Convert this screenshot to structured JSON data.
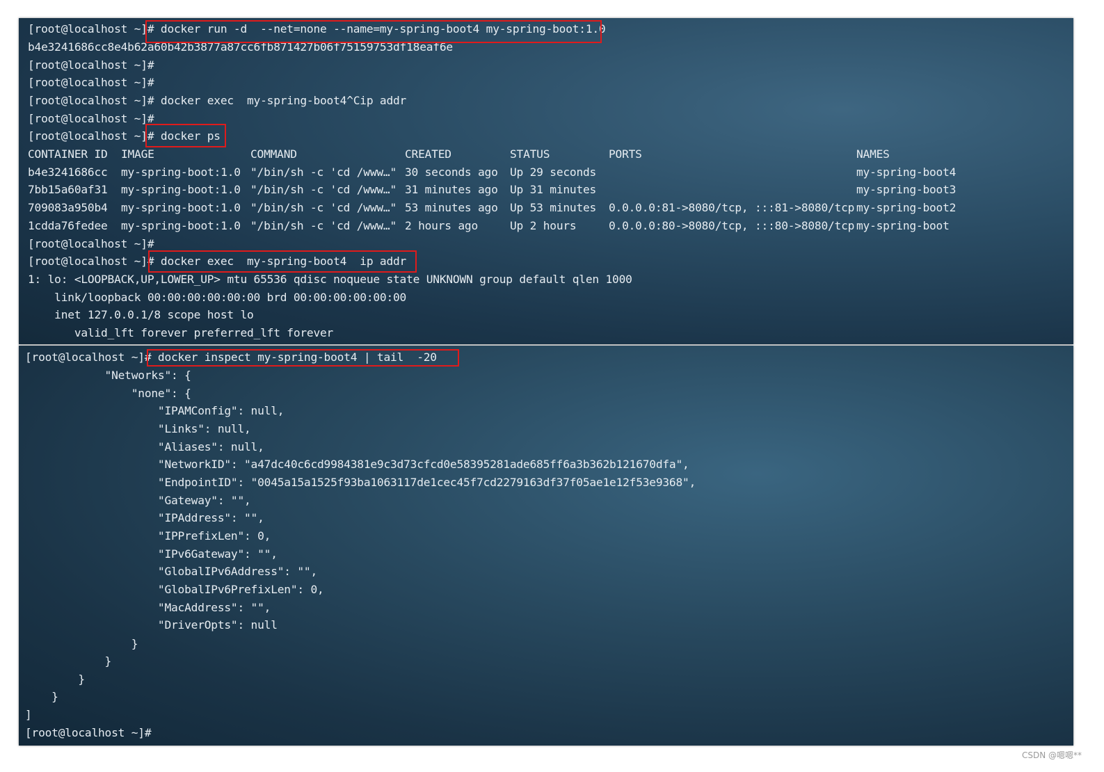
{
  "accent": {
    "highlight_color": "#e01b1b",
    "terminal_text": "#e6ecf1"
  },
  "top_terminal": {
    "lines": [
      "[root@localhost ~]# docker run -d  --net=none --name=my-spring-boot4 my-spring-boot:1.0",
      "b4e3241686cc8e4b62a60b42b3877a87cc6fb871427b06f75159753df18eaf6e",
      "[root@localhost ~]#",
      "[root@localhost ~]#",
      "[root@localhost ~]# docker exec  my-spring-boot4^Cip addr",
      "[root@localhost ~]#",
      "[root@localhost ~]# docker ps"
    ],
    "table": {
      "headers": [
        "CONTAINER ID",
        "IMAGE",
        "COMMAND",
        "CREATED",
        "STATUS",
        "PORTS",
        "NAMES"
      ],
      "rows": [
        [
          "b4e3241686cc",
          "my-spring-boot:1.0",
          "\"/bin/sh -c 'cd /www…\"",
          "30 seconds ago",
          "Up 29 seconds",
          "",
          "my-spring-boot4"
        ],
        [
          "7bb15a60af31",
          "my-spring-boot:1.0",
          "\"/bin/sh -c 'cd /www…\"",
          "31 minutes ago",
          "Up 31 minutes",
          "",
          "my-spring-boot3"
        ],
        [
          "709083a950b4",
          "my-spring-boot:1.0",
          "\"/bin/sh -c 'cd /www…\"",
          "53 minutes ago",
          "Up 53 minutes",
          "0.0.0.0:81->8080/tcp, :::81->8080/tcp",
          "my-spring-boot2"
        ],
        [
          "1cdda76fedee",
          "my-spring-boot:1.0",
          "\"/bin/sh -c 'cd /www…\"",
          "2 hours ago",
          "Up 2 hours",
          "0.0.0.0:80->8080/tcp, :::80->8080/tcp",
          "my-spring-boot"
        ]
      ]
    },
    "after_lines": [
      "[root@localhost ~]#",
      "[root@localhost ~]# docker exec  my-spring-boot4  ip addr",
      "1: lo: <LOOPBACK,UP,LOWER_UP> mtu 65536 qdisc noqueue state UNKNOWN group default qlen 1000",
      "    link/loopback 00:00:00:00:00:00 brd 00:00:00:00:00:00",
      "    inet 127.0.0.1/8 scope host lo",
      "       valid_lft forever preferred_lft forever"
    ]
  },
  "bottom_terminal": {
    "lines": [
      "[root@localhost ~]# docker inspect my-spring-boot4 | tail  -20",
      "            \"Networks\": {",
      "                \"none\": {",
      "                    \"IPAMConfig\": null,",
      "                    \"Links\": null,",
      "                    \"Aliases\": null,",
      "                    \"NetworkID\": \"a47dc40c6cd9984381e9c3d73cfcd0e58395281ade685ff6a3b362b121670dfa\",",
      "                    \"EndpointID\": \"0045a15a1525f93ba1063117de1cec45f7cd2279163df37f05ae1e12f53e9368\",",
      "                    \"Gateway\": \"\",",
      "                    \"IPAddress\": \"\",",
      "                    \"IPPrefixLen\": 0,",
      "                    \"IPv6Gateway\": \"\",",
      "                    \"GlobalIPv6Address\": \"\",",
      "                    \"GlobalIPv6PrefixLen\": 0,",
      "                    \"MacAddress\": \"\",",
      "                    \"DriverOpts\": null",
      "                }",
      "            }",
      "        }",
      "    }",
      "]",
      "[root@localhost ~]#"
    ]
  },
  "watermark": "CSDN @嗯嗯**"
}
